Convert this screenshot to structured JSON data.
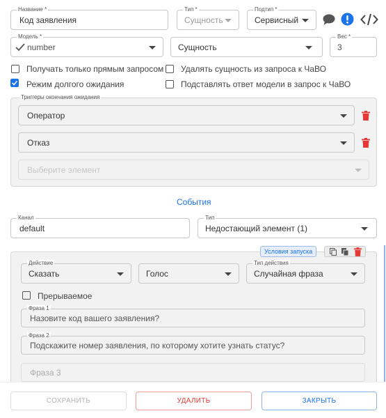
{
  "header": {
    "name_label": "Название *",
    "name_value": "Код заявления",
    "type_label": "Тип *",
    "type_value": "Сущность",
    "subtype_label": "Подтип *",
    "subtype_value": "Сервисный"
  },
  "model": {
    "model_label": "Модель *",
    "model_value": "number",
    "entity_value": "Сущность",
    "weight_label": "Вес *",
    "weight_value": "3"
  },
  "options": [
    {
      "label": "Получать только прямым запросом",
      "checked": false
    },
    {
      "label": "Удалять сущность из запроса к ЧаВО",
      "checked": false
    },
    {
      "label": "Режим долгого ожидания",
      "checked": true
    },
    {
      "label": "Подставлять ответ модели в запрос к ЧаВО",
      "checked": false
    }
  ],
  "triggers": {
    "title": "Триггеры окончания ожидания",
    "items": [
      "Оператор",
      "Отказ"
    ],
    "placeholder": "Выберите элемент"
  },
  "events": {
    "title": "События",
    "channel_label": "Канал",
    "channel_value": "default",
    "type_label": "Тип",
    "type_value": "Недостающий элемент (1)"
  },
  "action": {
    "conditions_label": "Условия запуска",
    "action_label": "Действие",
    "action_value": "Сказать",
    "mode_value": "Голос",
    "action_type_label": "Тип действия",
    "action_type_value": "Случайная фраза",
    "interruptible_label": "Прерываемое",
    "phrases": [
      {
        "label": "Фраза 1",
        "value": "Назовите код вашего заявления?"
      },
      {
        "label": "Фраза 2",
        "value": "Подскажите номер заявления, по которому хотите узнать статус?"
      }
    ],
    "phrase3_placeholder": "Фраза 3"
  },
  "footer": {
    "save": "СОХРАНИТЬ",
    "delete": "УДАЛИТЬ",
    "close": "ЗАКРЫТЬ"
  },
  "colors": {
    "accent": "#1a73e8",
    "danger": "#e53935",
    "check": "#1a73e8",
    "panel": "#f2f2f2"
  }
}
